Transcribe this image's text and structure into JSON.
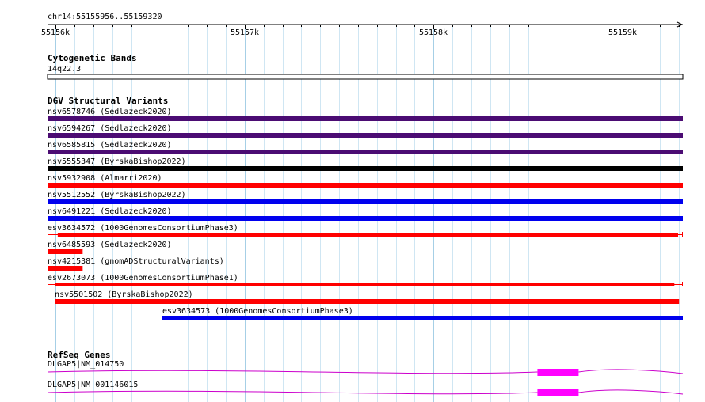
{
  "region": "chr14:55155956..55159320",
  "ruler": {
    "start": 55155956,
    "end": 55159320,
    "major_ticks": [
      {
        "pos": 55156000,
        "label": "55156k"
      },
      {
        "pos": 55157000,
        "label": "55157k"
      },
      {
        "pos": 55158000,
        "label": "55158k"
      },
      {
        "pos": 55159000,
        "label": "55159k"
      }
    ]
  },
  "tracks": {
    "cyto": {
      "title": "Cytogenetic Bands",
      "band": "14q22.3"
    },
    "dgv": {
      "title": "DGV Structural Variants",
      "features": [
        {
          "label": "nsv6578746 (Sedlazeck2020)",
          "start": 55155956,
          "end": 55159320,
          "color": "#4b0c73",
          "style": "bar"
        },
        {
          "label": "nsv6594267 (Sedlazeck2020)",
          "start": 55155956,
          "end": 55159320,
          "color": "#4b0c73",
          "style": "bar"
        },
        {
          "label": "nsv6585815 (Sedlazeck2020)",
          "start": 55155956,
          "end": 55159320,
          "color": "#4b0c73",
          "style": "bar"
        },
        {
          "label": "nsv5555347 (ByrskaBishop2022)",
          "start": 55155956,
          "end": 55159320,
          "color": "#000000",
          "style": "bar"
        },
        {
          "label": "nsv5932908 (Almarri2020)",
          "start": 55155956,
          "end": 55159320,
          "color": "#ff0000",
          "style": "bar"
        },
        {
          "label": "nsv5512552 (ByrskaBishop2022)",
          "start": 55155956,
          "end": 55159320,
          "color": "#0000ee",
          "style": "bar"
        },
        {
          "label": "nsv6491221 (Sedlazeck2020)",
          "start": 55155956,
          "end": 55159320,
          "color": "#0000ee",
          "style": "bar"
        },
        {
          "label": "esv3634572 (1000GenomesConsortiumPhase3)",
          "start": 55155956,
          "end": 55159320,
          "color": "#ff0000",
          "style": "capped",
          "inner_start": 55156010,
          "inner_end": 55159295
        },
        {
          "label": "nsv6485593 (Sedlazeck2020)",
          "start": 55155956,
          "end": 55156142,
          "color": "#ff0000",
          "style": "bar"
        },
        {
          "label": "nsv4215381 (gnomADStructuralVariants)",
          "start": 55155956,
          "end": 55156142,
          "color": "#ff0000",
          "style": "bar"
        },
        {
          "label": "esv2673073 (1000GenomesConsortiumPhase1)",
          "start": 55155956,
          "end": 55159320,
          "color": "#ff0000",
          "style": "capped",
          "inner_start": 55155994,
          "inner_end": 55159275
        },
        {
          "label": "nsv5501502 (ByrskaBishop2022)",
          "start": 55155994,
          "end": 55159300,
          "color": "#ff0000",
          "style": "bar"
        },
        {
          "label": "esv3634573 (1000GenomesConsortiumPhase3)",
          "start": 55156564,
          "end": 55159320,
          "color": "#0000ee",
          "style": "bar"
        }
      ]
    },
    "refseq": {
      "title": "RefSeq Genes",
      "genes": [
        {
          "label": "DLGAP5|NM_014750",
          "intron_color": "#cc00cc",
          "exon_color": "#ff00ff",
          "exons": [
            {
              "start": 55158550,
              "end": 55158768
            }
          ]
        },
        {
          "label": "DLGAP5|NM_001146015",
          "intron_color": "#cc00cc",
          "exon_color": "#ff00ff",
          "exons": [
            {
              "start": 55158550,
              "end": 55158768
            }
          ]
        }
      ]
    }
  }
}
